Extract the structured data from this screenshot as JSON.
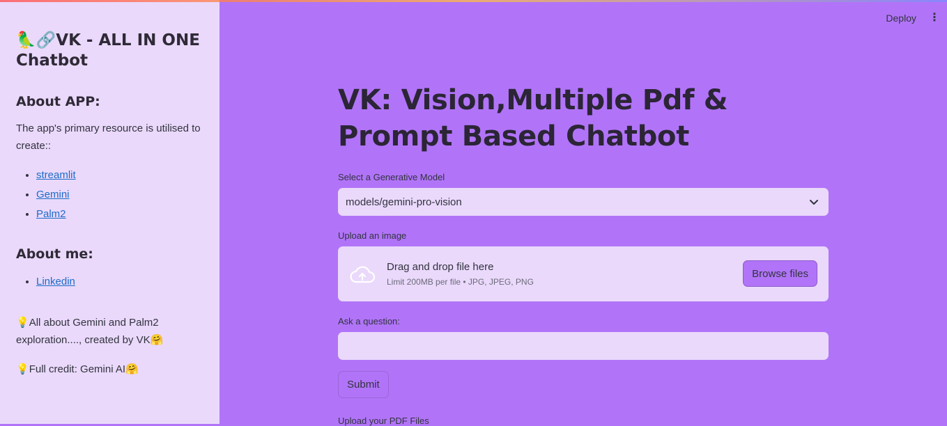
{
  "app": {
    "title_emojis": "🦜🔗",
    "title": "VK - ALL IN ONE Chatbot"
  },
  "sidebar": {
    "about_app_heading": "About APP:",
    "about_app_text": "The app's primary resource is utilised to create::",
    "links": [
      "streamlit",
      "Gemini",
      "Palm2"
    ],
    "about_me_heading": "About me:",
    "about_me_links": [
      "Linkedin"
    ],
    "note1_prefix": "💡",
    "note1_text": "All about Gemini and Palm2 exploration...., created by VK",
    "note1_suffix": "🤗",
    "note2_prefix": "💡",
    "note2_text": "Full credit: Gemini AI",
    "note2_suffix": "🤗"
  },
  "header": {
    "deploy_label": "Deploy",
    "menu_icon": "⋮"
  },
  "main": {
    "title": "VK: Vision,Multiple Pdf & Prompt Based Chatbot",
    "model_label": "Select a Generative Model",
    "model_value": "models/gemini-pro-vision",
    "upload_image_label": "Upload an image",
    "upload_drag_text": "Drag and drop file here",
    "upload_limit_text": "Limit 200MB per file • JPG, JPEG, PNG",
    "browse_label": "Browse files",
    "question_label": "Ask a question:",
    "question_value": "",
    "submit_label": "Submit",
    "pdf_label": "Upload your PDF Files"
  },
  "colors": {
    "main_bg": "#b174f8",
    "sidebar_bg": "#ead9fb",
    "link": "#1c6cc8"
  },
  "icons": [
    "cloud-upload-icon",
    "chevron-down-icon",
    "more-vertical-icon"
  ]
}
